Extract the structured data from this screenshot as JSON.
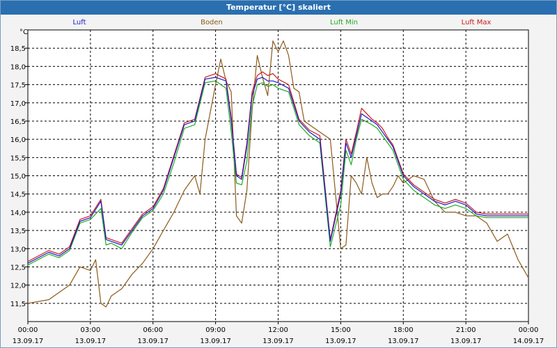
{
  "window": {
    "title": "Temperatur [°C] skaliert"
  },
  "chart_data": {
    "type": "line",
    "title": "Temperatur [°C] skaliert",
    "ylabel": "°C",
    "xlabel": "",
    "ylim": [
      11.0,
      19.0
    ],
    "xlim": [
      0,
      24
    ],
    "grid": true,
    "legend": "top",
    "y_ticks": [
      "18,5",
      "18,0",
      "17,5",
      "17,0",
      "16,5",
      "16,0",
      "15,5",
      "15,0",
      "14,5",
      "14,0",
      "13,5",
      "13,0",
      "12,5",
      "12,0",
      "11,5"
    ],
    "x_ticks": [
      {
        "time": "00:00",
        "date": "13.09.17"
      },
      {
        "time": "03:00",
        "date": "13.09.17"
      },
      {
        "time": "06:00",
        "date": "13.09.17"
      },
      {
        "time": "09:00",
        "date": "13.09.17"
      },
      {
        "time": "12:00",
        "date": "13.09.17"
      },
      {
        "time": "15:00",
        "date": "13.09.17"
      },
      {
        "time": "18:00",
        "date": "13.09.17"
      },
      {
        "time": "21:00",
        "date": "13.09.17"
      },
      {
        "time": "00:00",
        "date": "14.09.17"
      }
    ],
    "series": [
      {
        "name": "Luft",
        "color": "#1a1acc",
        "x": [
          0,
          1,
          1.5,
          2,
          2.5,
          3,
          3.5,
          3.75,
          4,
          4.5,
          5,
          5.5,
          6,
          6.5,
          7,
          7.5,
          8,
          8.5,
          9,
          9.5,
          9.75,
          10,
          10.25,
          10.5,
          10.75,
          11,
          11.25,
          11.5,
          11.75,
          12,
          12.5,
          13,
          13.5,
          14,
          14.5,
          15,
          15.25,
          15.5,
          15.75,
          16,
          16.5,
          16.75,
          17,
          17.25,
          17.5,
          17.75,
          18,
          18.5,
          19,
          19.5,
          20,
          20.5,
          21,
          21.5,
          22,
          22.5,
          23,
          23.5,
          24
        ],
        "y": [
          12.6,
          12.9,
          12.8,
          13.0,
          13.75,
          13.85,
          14.3,
          13.25,
          13.2,
          13.1,
          13.5,
          13.9,
          14.1,
          14.6,
          15.5,
          16.4,
          16.5,
          17.65,
          17.7,
          17.6,
          16.5,
          15.0,
          14.9,
          15.8,
          17.2,
          17.65,
          17.7,
          17.6,
          17.6,
          17.55,
          17.4,
          16.5,
          16.2,
          16.0,
          13.2,
          14.5,
          15.9,
          15.5,
          16.1,
          16.7,
          16.5,
          16.4,
          16.2,
          16.0,
          15.8,
          15.4,
          15.0,
          14.7,
          14.5,
          14.3,
          14.2,
          14.3,
          14.2,
          13.95,
          13.9,
          13.9,
          13.9,
          13.9,
          13.9
        ]
      },
      {
        "name": "Boden",
        "color": "#8b5a1a",
        "x": [
          0,
          1,
          2,
          2.5,
          3,
          3.25,
          3.5,
          3.75,
          4,
          4.5,
          5,
          5.5,
          6,
          6.5,
          7,
          7.5,
          8,
          8.25,
          8.5,
          9,
          9.25,
          9.5,
          9.75,
          10,
          10.25,
          10.5,
          10.75,
          11,
          11.25,
          11.5,
          11.75,
          12,
          12.25,
          12.5,
          12.75,
          13,
          13.25,
          13.5,
          14,
          14.5,
          15,
          15.25,
          15.5,
          15.75,
          16,
          16.25,
          16.5,
          16.75,
          17,
          17.25,
          17.5,
          17.75,
          18,
          18.5,
          19,
          19.5,
          20,
          20.5,
          21,
          21.5,
          22,
          22.5,
          23,
          23.5,
          24
        ],
        "y": [
          11.5,
          11.6,
          12.0,
          12.5,
          12.4,
          12.7,
          11.5,
          11.4,
          11.7,
          11.9,
          12.3,
          12.6,
          13.0,
          13.5,
          14.0,
          14.6,
          15.0,
          14.5,
          16.0,
          17.5,
          18.2,
          17.6,
          17.3,
          13.9,
          13.7,
          14.6,
          16.8,
          18.3,
          17.7,
          17.2,
          18.7,
          18.4,
          18.7,
          18.3,
          17.4,
          17.3,
          16.5,
          16.4,
          16.2,
          16.0,
          13.0,
          13.1,
          15.0,
          14.8,
          14.5,
          15.5,
          14.8,
          14.4,
          14.5,
          14.5,
          14.7,
          15.0,
          14.8,
          15.0,
          14.9,
          14.3,
          14.0,
          14.0,
          13.9,
          13.9,
          13.7,
          13.2,
          13.4,
          12.7,
          12.2
        ]
      },
      {
        "name": "Luft Min",
        "color": "#22aa22",
        "x": [
          0,
          1,
          1.5,
          2,
          2.5,
          3,
          3.5,
          3.75,
          4,
          4.5,
          5,
          5.5,
          6,
          6.5,
          7,
          7.5,
          8,
          8.5,
          9,
          9.5,
          9.75,
          10,
          10.25,
          10.5,
          10.75,
          11,
          11.25,
          11.5,
          11.75,
          12,
          12.5,
          13,
          13.5,
          14,
          14.5,
          15,
          15.25,
          15.5,
          15.75,
          16,
          16.5,
          16.75,
          17,
          17.25,
          17.5,
          17.75,
          18,
          18.5,
          19,
          19.5,
          20,
          20.5,
          21,
          21.5,
          22,
          22.5,
          23,
          23.5,
          24
        ],
        "y": [
          12.55,
          12.85,
          12.75,
          12.95,
          13.7,
          13.8,
          14.1,
          13.1,
          13.15,
          13.0,
          13.45,
          13.85,
          14.05,
          14.5,
          15.35,
          16.3,
          16.4,
          17.55,
          17.6,
          17.4,
          16.2,
          14.8,
          14.75,
          15.4,
          16.9,
          17.5,
          17.55,
          17.45,
          17.5,
          17.4,
          17.3,
          16.4,
          16.1,
          15.9,
          13.05,
          14.2,
          15.7,
          15.3,
          16.0,
          16.55,
          16.4,
          16.3,
          16.1,
          15.9,
          15.7,
          15.3,
          14.9,
          14.6,
          14.4,
          14.2,
          14.1,
          14.2,
          14.1,
          13.9,
          13.85,
          13.85,
          13.85,
          13.85,
          13.85
        ]
      },
      {
        "name": "Luft Max",
        "color": "#cc1a1a",
        "x": [
          0,
          1,
          1.5,
          2,
          2.5,
          3,
          3.5,
          3.75,
          4,
          4.5,
          5,
          5.5,
          6,
          6.5,
          7,
          7.5,
          8,
          8.5,
          9,
          9.5,
          9.75,
          10,
          10.25,
          10.5,
          10.75,
          11,
          11.25,
          11.5,
          11.75,
          12,
          12.5,
          13,
          13.5,
          14,
          14.5,
          15,
          15.25,
          15.5,
          15.75,
          16,
          16.5,
          16.75,
          17,
          17.25,
          17.5,
          17.75,
          18,
          18.5,
          19,
          19.5,
          20,
          20.5,
          21,
          21.5,
          22,
          22.5,
          23,
          23.5,
          24
        ],
        "y": [
          12.65,
          12.95,
          12.85,
          13.05,
          13.8,
          13.9,
          14.35,
          13.3,
          13.25,
          13.15,
          13.55,
          13.95,
          14.15,
          14.65,
          15.55,
          16.45,
          16.55,
          17.7,
          17.8,
          17.65,
          16.6,
          15.05,
          14.95,
          15.9,
          17.3,
          17.75,
          17.85,
          17.75,
          17.8,
          17.65,
          17.5,
          16.55,
          16.25,
          16.1,
          13.25,
          14.6,
          16.0,
          15.6,
          16.2,
          16.85,
          16.55,
          16.45,
          16.3,
          16.05,
          15.85,
          15.45,
          15.05,
          14.75,
          14.55,
          14.35,
          14.25,
          14.35,
          14.25,
          14.0,
          13.95,
          13.95,
          13.95,
          13.95,
          13.95
        ]
      }
    ]
  }
}
